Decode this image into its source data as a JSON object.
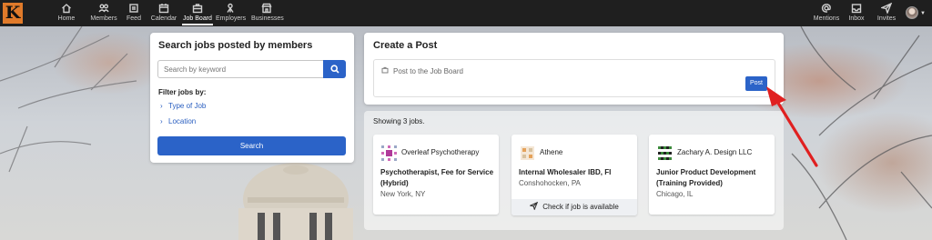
{
  "nav": {
    "logo_letter": "K",
    "items": [
      {
        "label": "Home",
        "icon": "home-icon"
      },
      {
        "label": "Members",
        "icon": "members-icon"
      },
      {
        "label": "Feed",
        "icon": "feed-icon"
      },
      {
        "label": "Calendar",
        "icon": "calendar-icon"
      },
      {
        "label": "Job Board",
        "icon": "briefcase-icon",
        "active": true
      },
      {
        "label": "Employers",
        "icon": "employers-icon"
      },
      {
        "label": "Businesses",
        "icon": "storefront-icon"
      }
    ],
    "right_items": [
      {
        "label": "Mentions",
        "icon": "at-icon"
      },
      {
        "label": "Inbox",
        "icon": "inbox-icon"
      },
      {
        "label": "Invites",
        "icon": "paper-plane-icon"
      }
    ]
  },
  "search": {
    "title": "Search jobs posted by members",
    "keyword_placeholder": "Search by keyword",
    "filter_label": "Filter jobs by:",
    "filters": [
      "Type of Job",
      "Location"
    ],
    "button_label": "Search"
  },
  "post": {
    "title": "Create a Post",
    "prompt": "Post to the Job Board",
    "button_label": "Post"
  },
  "jobs": {
    "count_text": "Showing 3 jobs.",
    "items": [
      {
        "company": "Overleaf Psychotherapy",
        "title": "Psychotherapist, Fee for Service (Hybrid)",
        "location": "New York, NY"
      },
      {
        "company": "Athene",
        "title": "Internal Wholesaler IBD, FI",
        "location": "Conshohocken, PA",
        "action": "Check if job is available"
      },
      {
        "company": "Zachary A. Design LLC",
        "title": "Junior Product Development (Training Provided)",
        "location": "Chicago, IL"
      }
    ]
  },
  "colors": {
    "accent": "#2b63c8",
    "nav_bg": "#1f1f1f",
    "logo_bg": "#e07a2a",
    "annotation_arrow": "#e02020"
  }
}
